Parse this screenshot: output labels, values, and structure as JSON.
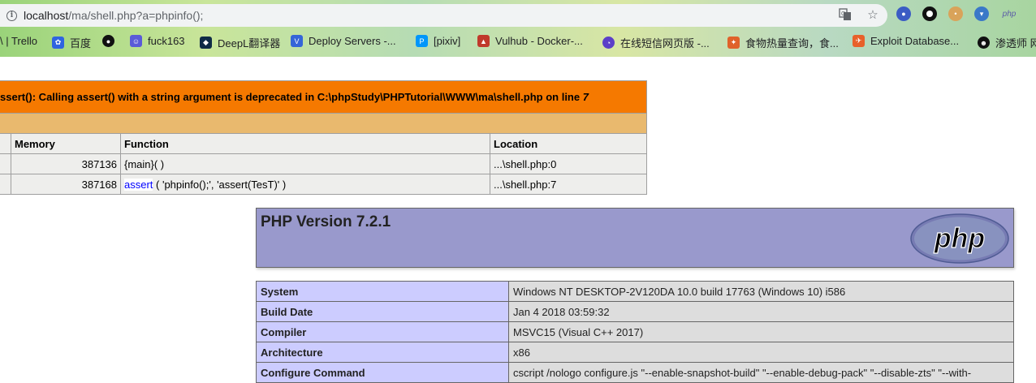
{
  "browser": {
    "url_host": "localhost",
    "url_path": "/ma/shell.php?a=phpinfo();",
    "info_icon": "info-icon",
    "extensions": [
      "github-ext-icon",
      "circle-ext-icon",
      "cookie-ext-icon",
      "shield-ext-icon",
      "php"
    ]
  },
  "bookmarks": [
    {
      "label": "\\ | Trello",
      "icon": "trello-icon"
    },
    {
      "label": "百度",
      "icon": "baidu-icon"
    },
    {
      "label": "",
      "icon": "github-icon"
    },
    {
      "label": "fuck163",
      "icon": "chat-icon"
    },
    {
      "label": "DeepL翻译器",
      "icon": "deepl-icon"
    },
    {
      "label": "Deploy Servers -...",
      "icon": "deploy-icon"
    },
    {
      "label": "[pixiv]",
      "icon": "pixiv-icon"
    },
    {
      "label": "Vulhub - Docker-...",
      "icon": "vulhub-icon"
    },
    {
      "label": "在线短信网页版 -...",
      "icon": "sms-icon"
    },
    {
      "label": "食物热量查询，食...",
      "icon": "food-icon"
    },
    {
      "label": "Exploit Database...",
      "icon": "exploitdb-icon"
    },
    {
      "label": "渗透师 网",
      "icon": "pentest-icon"
    }
  ],
  "xdebug": {
    "error_message": "ssert(): Calling assert() with a string argument is deprecated in C:\\phpStudy\\PHPTutorial\\WWW\\ma\\shell.php on line ",
    "error_line": "7",
    "headers": {
      "memory": "Memory",
      "function": "Function",
      "location": "Location"
    },
    "rows": [
      {
        "memory": "387136",
        "function": "{main}( )",
        "func_name": "",
        "args": "",
        "location": "...\\shell.php:0"
      },
      {
        "memory": "387168",
        "function": "",
        "func_name": "assert",
        "args": " ( 'phpinfo();', 'assert(TesT)' )",
        "location": "...\\shell.php:7"
      }
    ]
  },
  "phpinfo": {
    "version_title": "PHP Version 7.2.1",
    "logo_text": "php",
    "rows": [
      {
        "key": "System",
        "value": "Windows NT DESKTOP-2V120DA 10.0 build 17763 (Windows 10) i586"
      },
      {
        "key": "Build Date",
        "value": "Jan 4 2018 03:59:32"
      },
      {
        "key": "Compiler",
        "value": "MSVC15 (Visual C++ 2017)"
      },
      {
        "key": "Architecture",
        "value": "x86"
      },
      {
        "key": "Configure Command",
        "value": "cscript /nologo configure.js \"--enable-snapshot-build\" \"--enable-debug-pack\" \"--disable-zts\" \"--with-"
      }
    ]
  },
  "colors": {
    "error_bg": "#f57900",
    "callstack_bg": "#e9b96e",
    "php_header_bg": "#9999cc",
    "key_bg": "#ccccff",
    "value_bg": "#dddddd"
  }
}
